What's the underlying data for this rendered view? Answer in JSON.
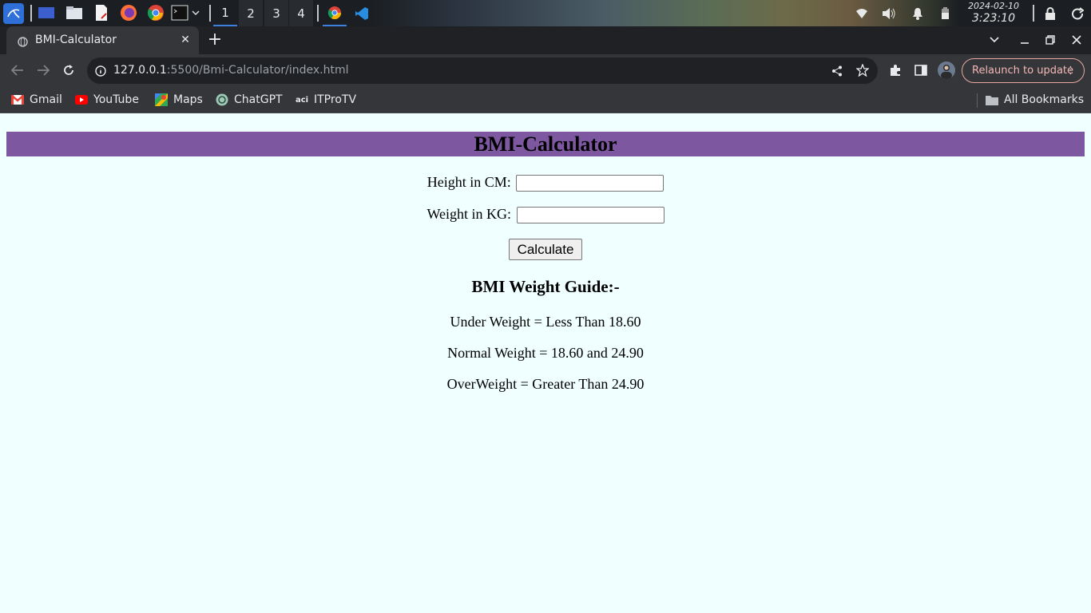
{
  "os": {
    "workspaces": [
      "1",
      "2",
      "3",
      "4"
    ],
    "active_workspace": "1",
    "clock_date": "2024-02-10",
    "clock_time": "3:23:10 am"
  },
  "browser": {
    "tab_title": "BMI-Calculator",
    "url_host": "127.0.0.1",
    "url_rest": ":5500/Bmi-Calculator/index.html",
    "relaunch_label": "Relaunch to update",
    "bookmarks": [
      "Gmail",
      "YouTube",
      "Maps",
      "ChatGPT",
      "ITProTV"
    ],
    "all_bookmarks_label": "All Bookmarks"
  },
  "page": {
    "title": "BMI-Calculator",
    "height_label": "Height in CM:",
    "height_value": "",
    "weight_label": "Weight in KG:",
    "weight_value": "",
    "calculate_label": "Calculate",
    "guide_title": "BMI Weight Guide:-",
    "guide_items": [
      "Under Weight = Less Than 18.60",
      "Normal Weight = 18.60 and 24.90",
      "OverWeight = Greater Than 24.90"
    ],
    "header_color": "#7d58a1",
    "background_color": "#f0ffff"
  }
}
